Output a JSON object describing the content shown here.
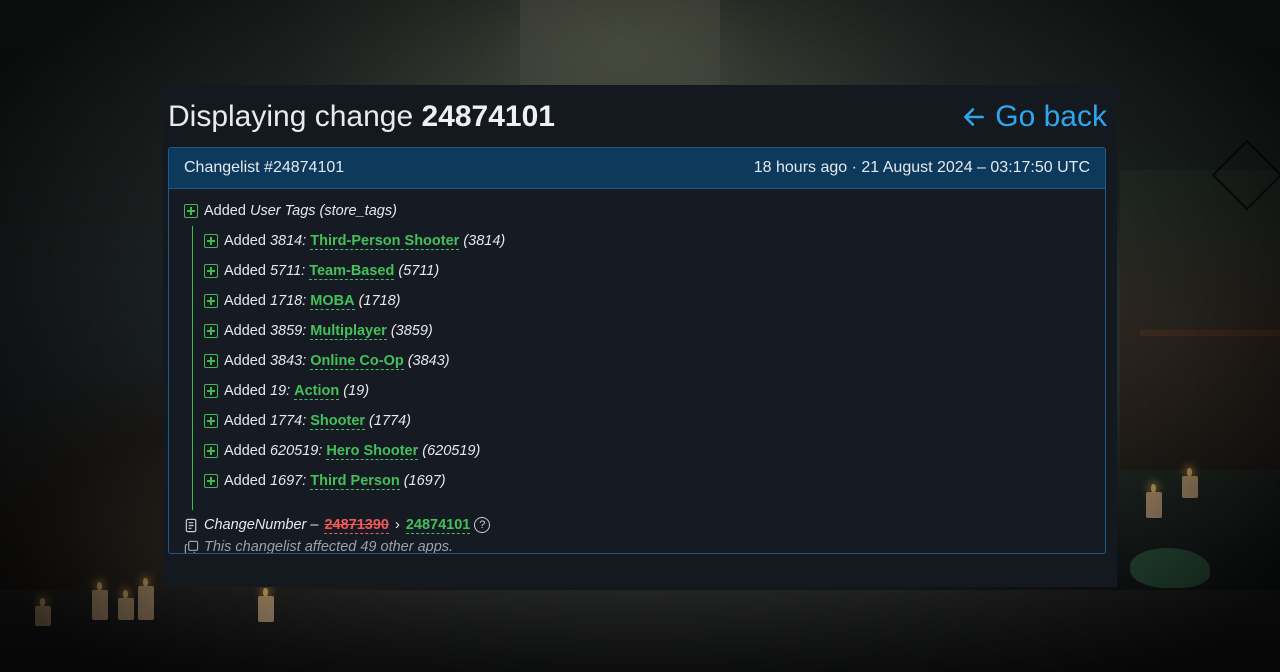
{
  "header": {
    "title_prefix": "Displaying change",
    "change_id": "24874101",
    "go_back_label": "Go back"
  },
  "changelist": {
    "title": "Changelist #24874101",
    "time": "18 hours ago · 21 August 2024 – 03:17:50 UTC",
    "section": {
      "verb": "Added",
      "name": "User Tags (store_tags)"
    },
    "tags": [
      {
        "verb": "Added",
        "key": "3814:",
        "label": "Third-Person Shooter",
        "id": "(3814)"
      },
      {
        "verb": "Added",
        "key": "5711:",
        "label": "Team-Based",
        "id": "(5711)"
      },
      {
        "verb": "Added",
        "key": "1718:",
        "label": "MOBA",
        "id": "(1718)"
      },
      {
        "verb": "Added",
        "key": "3859:",
        "label": "Multiplayer",
        "id": "(3859)"
      },
      {
        "verb": "Added",
        "key": "3843:",
        "label": "Online Co-Op",
        "id": "(3843)"
      },
      {
        "verb": "Added",
        "key": "19:",
        "label": "Action",
        "id": "(19)"
      },
      {
        "verb": "Added",
        "key": "1774:",
        "label": "Shooter",
        "id": "(1774)"
      },
      {
        "verb": "Added",
        "key": "620519:",
        "label": "Hero Shooter",
        "id": "(620519)"
      },
      {
        "verb": "Added",
        "key": "1697:",
        "label": "Third Person",
        "id": "(1697)"
      }
    ],
    "change_number": {
      "label": "ChangeNumber –",
      "old": "24871390",
      "arrow": "›",
      "new": "24874101",
      "help": "?"
    },
    "affected": "This changelist affected 49 other apps."
  },
  "colors": {
    "accent": "#2ea6ec",
    "added": "#43c05a",
    "removed": "#f05757",
    "card_header": "#0d3a5c"
  },
  "icons": [
    "arrow-left-icon",
    "plus-square-icon",
    "document-icon",
    "help-icon",
    "copy-icon"
  ]
}
